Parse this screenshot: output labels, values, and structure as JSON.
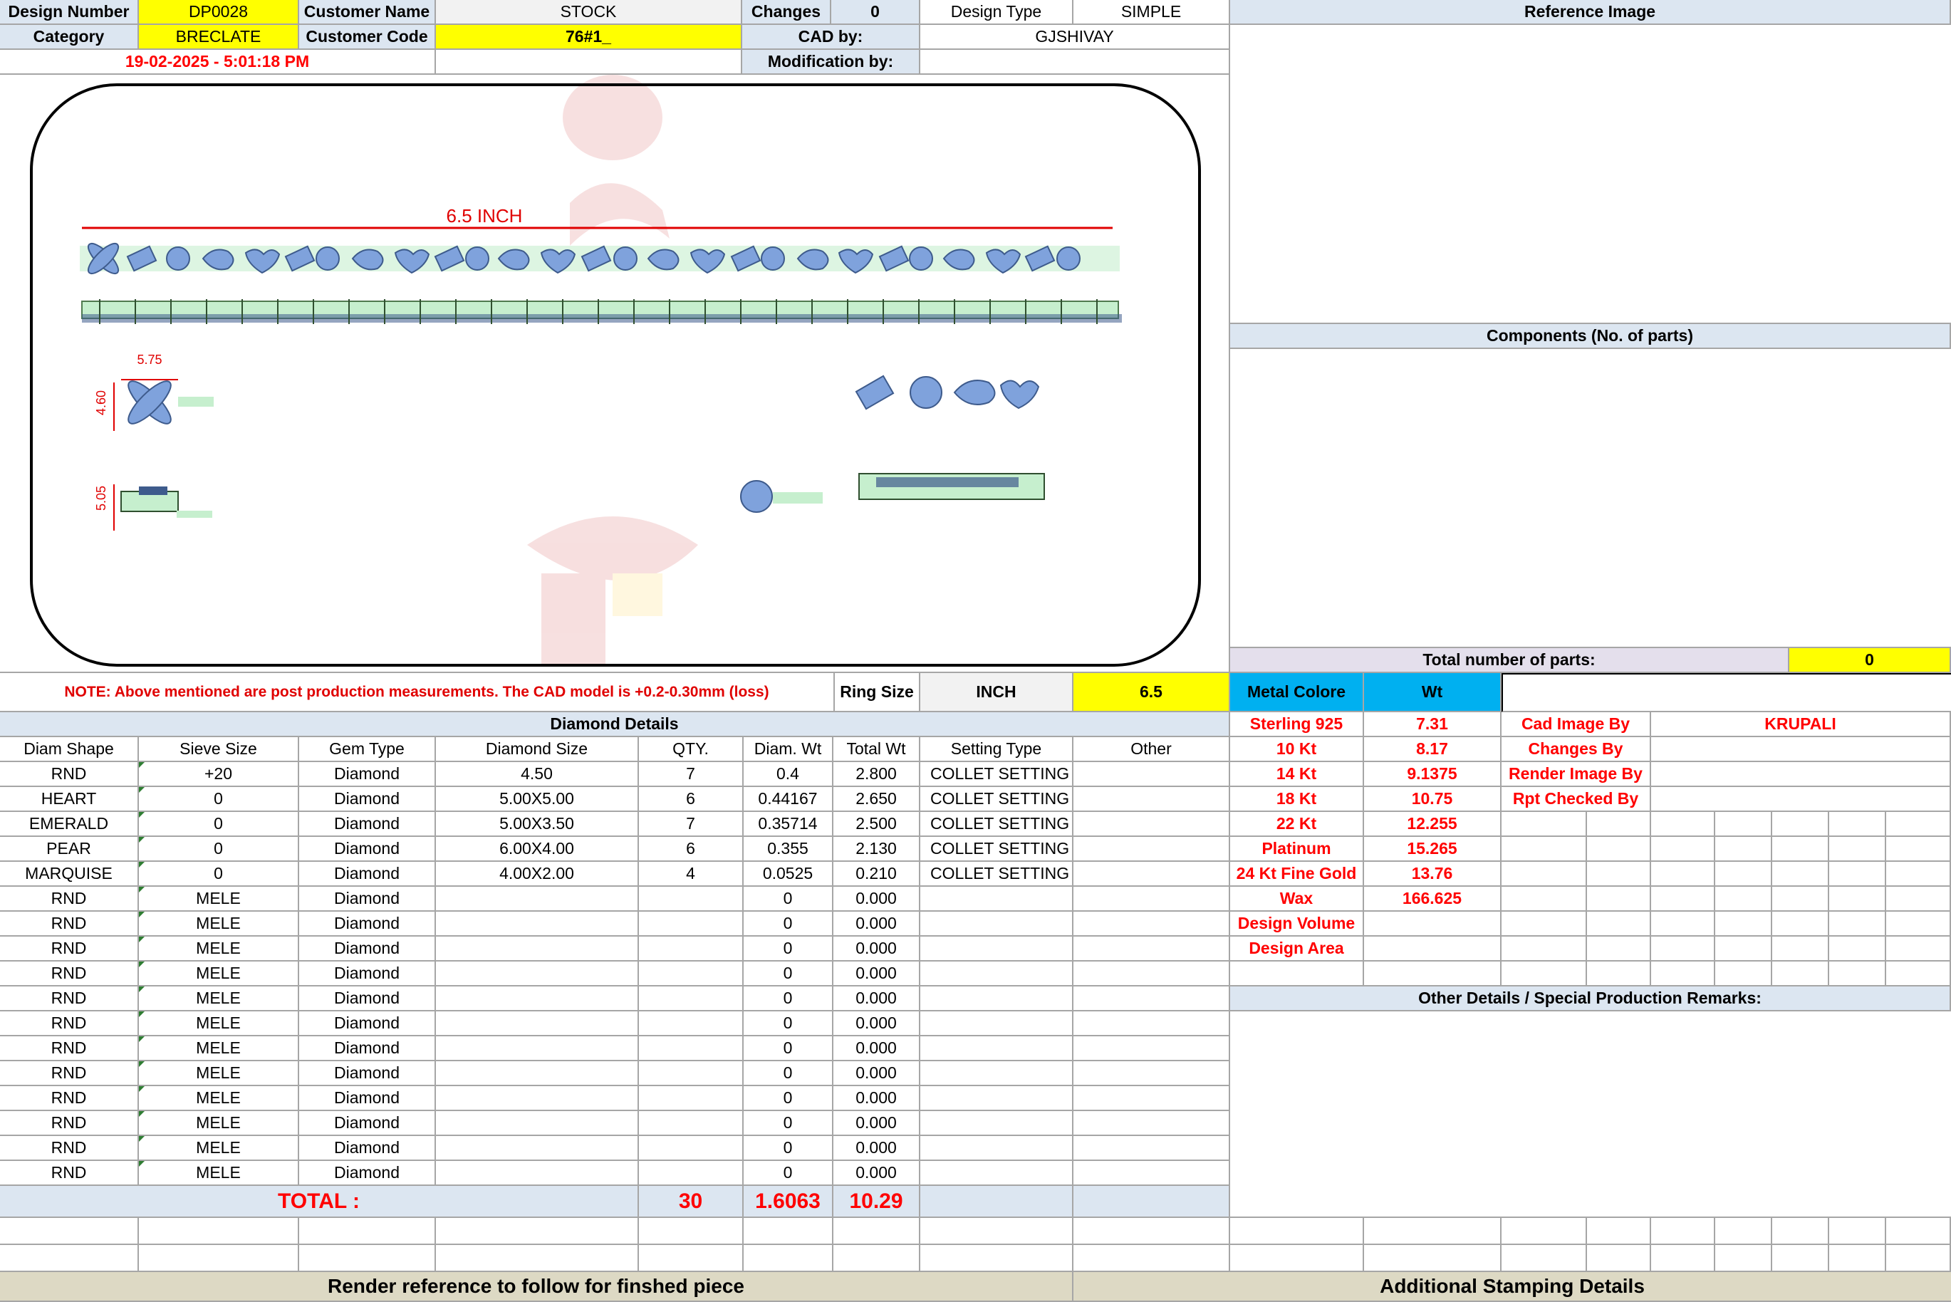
{
  "header": {
    "design_number_label": "Design Number",
    "design_number": "DP0028",
    "customer_name_label": "Customer Name",
    "customer_name": "STOCK",
    "changes_label": "Changes",
    "changes": "0",
    "design_type_label": "Design Type",
    "design_type": "SIMPLE",
    "category_label": "Category",
    "category": "BRECLATE",
    "customer_code_label": "Customer Code",
    "customer_code": "76#1_",
    "cad_by_label": "CAD by:",
    "cad_by": "GJSHIVAY",
    "timestamp": "19-02-2025 - 5:01:18 PM",
    "modification_label": "Modification by:",
    "modification_by": ""
  },
  "drawing": {
    "length_label": "6.5 INCH",
    "dim_width": "5.75",
    "dim_height": "4.60",
    "dim_side": "5.05"
  },
  "note": "NOTE: Above mentioned are post production measurements. The CAD model is +0.2-0.30mm (loss)",
  "ring": {
    "label": "Ring Size",
    "unit": "INCH",
    "value": "6.5"
  },
  "right_panel": {
    "reference_image_title": "Reference Image",
    "components_title": "Components (No. of parts)",
    "total_parts_label": "Total number of parts:",
    "total_parts_value": "0",
    "metal_colore_label": "Metal Colore",
    "wt_label": "Wt",
    "metals": [
      {
        "name": "Sterling 925",
        "wt": "7.31"
      },
      {
        "name": "10 Kt",
        "wt": "8.17"
      },
      {
        "name": "14 Kt",
        "wt": "9.1375"
      },
      {
        "name": "18 Kt",
        "wt": "10.75"
      },
      {
        "name": "22 Kt",
        "wt": "12.255"
      },
      {
        "name": "Platinum",
        "wt": "15.265"
      },
      {
        "name": "24 Kt Fine Gold",
        "wt": "13.76"
      },
      {
        "name": "Wax",
        "wt": "166.625"
      },
      {
        "name": "Design Volume",
        "wt": ""
      },
      {
        "name": "Design Area",
        "wt": ""
      }
    ],
    "credits": [
      {
        "label": "Cad Image By",
        "value": "KRUPALI"
      },
      {
        "label": "Changes By",
        "value": ""
      },
      {
        "label": "Render Image By",
        "value": ""
      },
      {
        "label": "Rpt Checked By",
        "value": ""
      }
    ],
    "other_details_title": "Other Details / Special Production Remarks:"
  },
  "diamond_table": {
    "title": "Diamond Details",
    "columns": [
      "Diam Shape",
      "Sieve Size",
      "Gem Type",
      "Diamond Size",
      "QTY.",
      "Diam. Wt",
      "Total Wt",
      "Setting Type",
      "Other"
    ],
    "rows": [
      [
        "RND",
        "+20",
        "Diamond",
        "4.50",
        "7",
        "0.4",
        "2.800",
        "COLLET SETTING",
        ""
      ],
      [
        "HEART",
        "0",
        "Diamond",
        "5.00X5.00",
        "6",
        "0.44167",
        "2.650",
        "COLLET SETTING",
        ""
      ],
      [
        "EMERALD",
        "0",
        "Diamond",
        "5.00X3.50",
        "7",
        "0.35714",
        "2.500",
        "COLLET SETTING",
        ""
      ],
      [
        "PEAR",
        "0",
        "Diamond",
        "6.00X4.00",
        "6",
        "0.355",
        "2.130",
        "COLLET SETTING",
        ""
      ],
      [
        "MARQUISE",
        "0",
        "Diamond",
        "4.00X2.00",
        "4",
        "0.0525",
        "0.210",
        "COLLET SETTING",
        ""
      ],
      [
        "RND",
        "MELE",
        "Diamond",
        "",
        "",
        "0",
        "0.000",
        "",
        ""
      ],
      [
        "RND",
        "MELE",
        "Diamond",
        "",
        "",
        "0",
        "0.000",
        "",
        ""
      ],
      [
        "RND",
        "MELE",
        "Diamond",
        "",
        "",
        "0",
        "0.000",
        "",
        ""
      ],
      [
        "RND",
        "MELE",
        "Diamond",
        "",
        "",
        "0",
        "0.000",
        "",
        ""
      ],
      [
        "RND",
        "MELE",
        "Diamond",
        "",
        "",
        "0",
        "0.000",
        "",
        ""
      ],
      [
        "RND",
        "MELE",
        "Diamond",
        "",
        "",
        "0",
        "0.000",
        "",
        ""
      ],
      [
        "RND",
        "MELE",
        "Diamond",
        "",
        "",
        "0",
        "0.000",
        "",
        ""
      ],
      [
        "RND",
        "MELE",
        "Diamond",
        "",
        "",
        "0",
        "0.000",
        "",
        ""
      ],
      [
        "RND",
        "MELE",
        "Diamond",
        "",
        "",
        "0",
        "0.000",
        "",
        ""
      ],
      [
        "RND",
        "MELE",
        "Diamond",
        "",
        "",
        "0",
        "0.000",
        "",
        ""
      ],
      [
        "RND",
        "MELE",
        "Diamond",
        "",
        "",
        "0",
        "0.000",
        "",
        ""
      ],
      [
        "RND",
        "MELE",
        "Diamond",
        "",
        "",
        "0",
        "0.000",
        "",
        ""
      ]
    ],
    "total_label": "TOTAL :",
    "total_qty": "30",
    "total_diam_wt": "1.6063",
    "total_wt": "10.29"
  },
  "footer": {
    "render_reference": "Render reference to follow for finshed piece",
    "stamping": "Additional Stamping Details"
  },
  "colors": {
    "header_blue": "#dce6f1",
    "yellow": "#ffff00",
    "sky": "#00b0f0",
    "red": "#ff0000",
    "beige": "#ddd9c4",
    "stone_blue": "#7fa2dc",
    "metal_green": "#c6efce"
  }
}
